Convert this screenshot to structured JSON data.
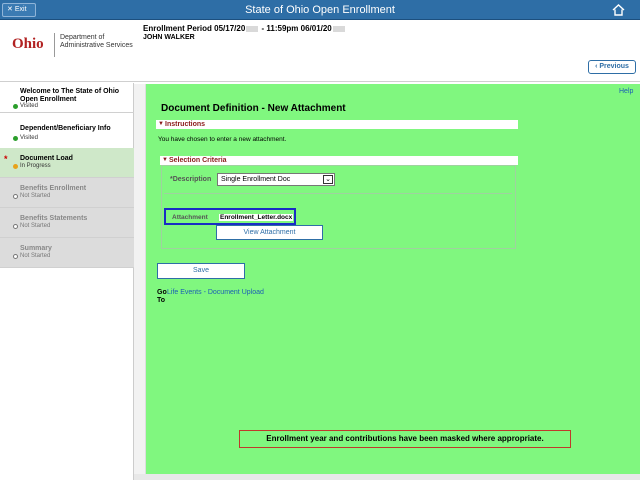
{
  "topbar": {
    "exit_label": "Exit",
    "title": "State of Ohio Open Enrollment",
    "accent": "#2e6ea6"
  },
  "header": {
    "logo_text": "Ohio",
    "logo_dept_line1": "Department of",
    "logo_dept_line2": "Administrative Services",
    "period_prefix": "Enrollment Period 05/17/20",
    "period_mid": " - 11:59pm 06/01/20",
    "person": "JOHN WALKER",
    "previous_label": "Previous"
  },
  "sidebar": {
    "items": [
      {
        "label_line1": "Welcome to The State of Ohio",
        "label_line2": "Open Enrollment",
        "status": "Visited"
      },
      {
        "label_line1": "Dependent/Beneficiary Info",
        "label_line2": "",
        "status": "Visited"
      },
      {
        "label_line1": "Document Load",
        "label_line2": "",
        "status": "In Progress"
      },
      {
        "label_line1": "Benefits Enrollment",
        "label_line2": "",
        "status": "Not Started"
      },
      {
        "label_line1": "Benefits Statements",
        "label_line2": "",
        "status": "Not Started"
      },
      {
        "label_line1": "Summary",
        "label_line2": "",
        "status": "Not Started"
      }
    ],
    "required_marker": "*"
  },
  "main": {
    "help_label": "Help",
    "page_title": "Document Definition - New Attachment",
    "instructions_header": "Instructions",
    "instructions_text": "You have chosen to enter a new attachment.",
    "criteria_header": "Selection Criteria",
    "description_label": "*Description",
    "description_value": "Single Enrollment Doc",
    "attachment_label": "Attachment",
    "attachment_value": "Enrollment_Letter.docx",
    "view_attachment_label": "View Attachment",
    "save_label": "Save",
    "goto_line1": "Go",
    "goto_line2": "To",
    "goto_link": "Life Events - Document Upload",
    "mask_notice": "Enrollment year and contributions have been masked where appropriate.",
    "background": "#80f77f"
  }
}
